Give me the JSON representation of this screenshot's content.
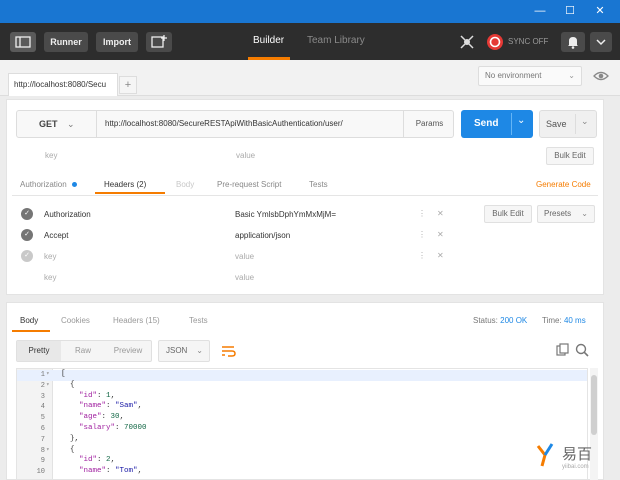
{
  "window": {
    "controls": [
      "—",
      "☐",
      "✕"
    ]
  },
  "appbar": {
    "runner": "Runner",
    "import": "Import",
    "builder": "Builder",
    "team_library": "Team Library",
    "sync": "SYNC OFF"
  },
  "tabs": {
    "active_tab": "http://localhost:8080/Secu",
    "new_tab": "+"
  },
  "environment": {
    "selected": "No environment",
    "eye_icon": "eye-icon"
  },
  "request": {
    "method": "GET",
    "url": "http://localhost:8080/SecureRESTApiWithBasicAuthentication/user/",
    "params": "Params",
    "send": "Send",
    "save": "Save"
  },
  "query_params": {
    "key_placeholder": "key",
    "value_placeholder": "value",
    "bulk_edit": "Bulk Edit"
  },
  "request_tabs": {
    "authorization": "Authorization",
    "headers": "Headers (2)",
    "body": "Body",
    "prerequest": "Pre-request Script",
    "tests": "Tests",
    "generate_code": "Generate Code"
  },
  "headers": {
    "bulk_edit": "Bulk Edit",
    "presets": "Presets",
    "rows": [
      {
        "key": "Authorization",
        "value": "Basic YmlsbDphYmMxMjM=",
        "enabled": true
      },
      {
        "key": "Accept",
        "value": "application/json",
        "enabled": true
      },
      {
        "key": "key",
        "value": "value",
        "enabled": false
      },
      {
        "key": "key",
        "value": "value",
        "enabled": false
      }
    ]
  },
  "response": {
    "tabs": {
      "body": "Body",
      "cookies": "Cookies",
      "headers": "Headers (15)",
      "tests": "Tests"
    },
    "status_label": "Status:",
    "status_value": "200 OK",
    "time_label": "Time:",
    "time_value": "40 ms",
    "view": {
      "pretty": "Pretty",
      "raw": "Raw",
      "preview": "Preview",
      "format": "JSON"
    }
  },
  "code_lines": [
    {
      "n": "1",
      "fold": true,
      "text": "["
    },
    {
      "n": "2",
      "fold": true,
      "text": "  {"
    },
    {
      "n": "3",
      "fold": false,
      "text": "    \"id\": 1,"
    },
    {
      "n": "4",
      "fold": false,
      "text": "    \"name\": \"Sam\","
    },
    {
      "n": "5",
      "fold": false,
      "text": "    \"age\": 30,"
    },
    {
      "n": "6",
      "fold": false,
      "text": "    \"salary\": 70000"
    },
    {
      "n": "7",
      "fold": false,
      "text": "  },"
    },
    {
      "n": "8",
      "fold": true,
      "text": "  {"
    },
    {
      "n": "9",
      "fold": false,
      "text": "    \"id\": 2,"
    },
    {
      "n": "10",
      "fold": false,
      "text": "    \"name\": \"Tom\","
    }
  ],
  "watermark": {
    "brand": "易百",
    "sub": "yiibai.com"
  },
  "colors": {
    "titlebar": "#1976d2",
    "send": "#1e88e5",
    "accent": "#f57c00",
    "sync": "#e53935"
  }
}
